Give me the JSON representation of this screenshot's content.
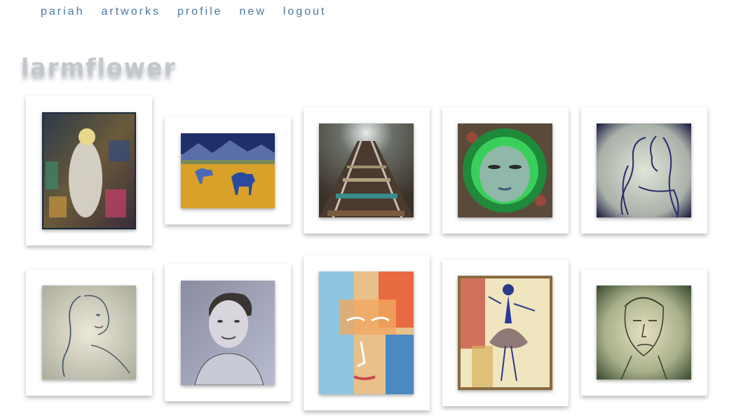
{
  "nav": {
    "items": [
      "pariah",
      "artworks",
      "profile",
      "new",
      "logout"
    ]
  },
  "page": {
    "title": "larmflower"
  },
  "artworks": [
    {
      "subject": "abstract figure painting"
    },
    {
      "subject": "blue horses in yellow field"
    },
    {
      "subject": "railroad tracks"
    },
    {
      "subject": "green glowing face"
    },
    {
      "subject": "woman line drawing"
    },
    {
      "subject": "smiling woman sketch"
    },
    {
      "subject": "young man pencil portrait"
    },
    {
      "subject": "abstract colorful face"
    },
    {
      "subject": "ballerina watercolor"
    },
    {
      "subject": "man sketch on green"
    }
  ]
}
